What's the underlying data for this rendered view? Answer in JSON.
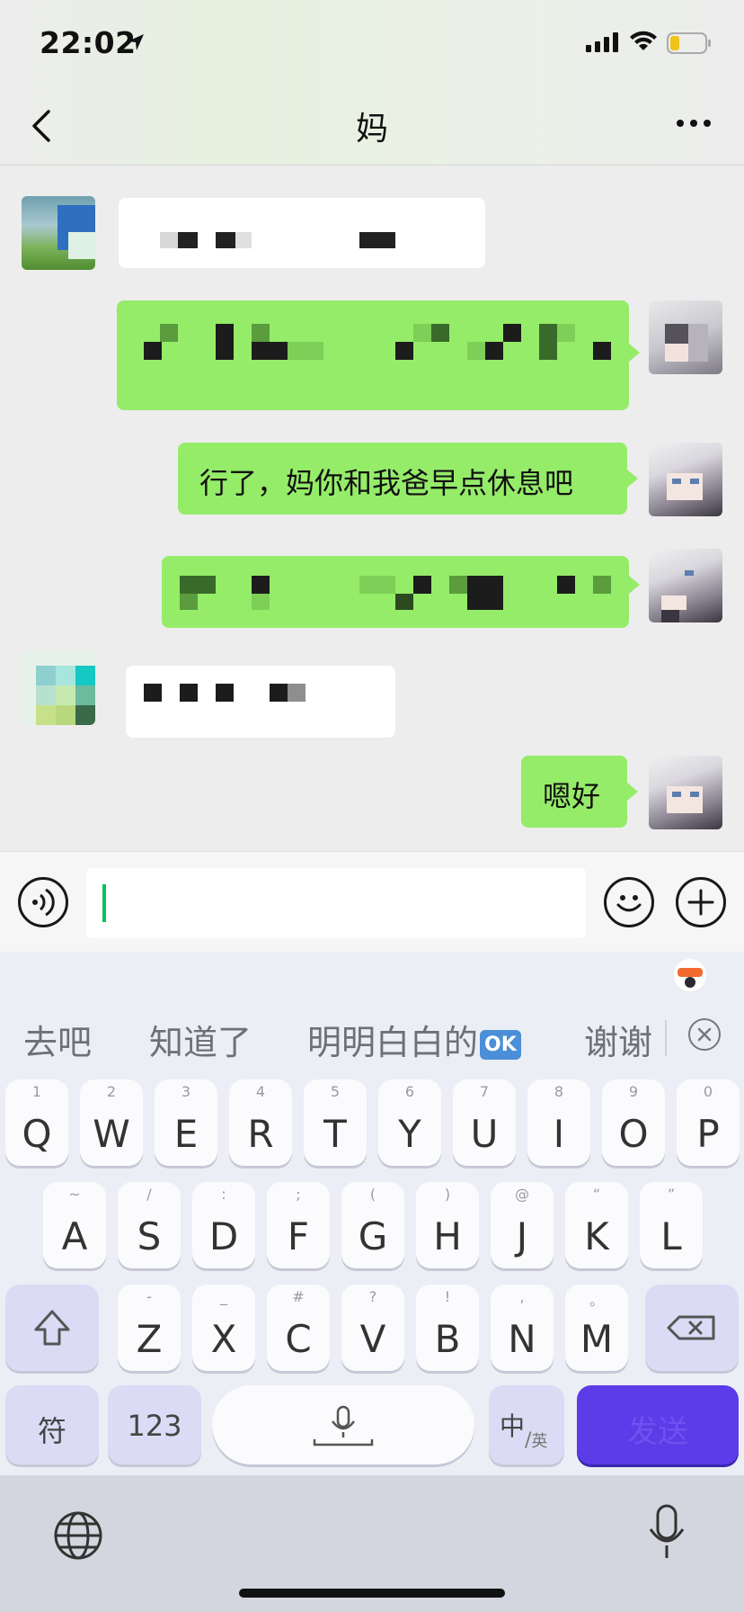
{
  "status_bar": {
    "time": "22:02"
  },
  "nav": {
    "title": "妈"
  },
  "messages": [
    {
      "side": "in",
      "text": ""
    },
    {
      "side": "out",
      "text": ""
    },
    {
      "side": "out",
      "text": "行了，妈你和我爸早点休息吧"
    },
    {
      "side": "out",
      "text": ""
    },
    {
      "side": "in",
      "text": ""
    },
    {
      "side": "out",
      "text": "嗯好"
    }
  ],
  "input": {
    "value": ""
  },
  "suggestions": [
    "去吧",
    "知道了",
    "明明白白的",
    "谢谢"
  ],
  "suggestion_badge": "OK",
  "keyboard": {
    "row1": [
      {
        "hint": "1",
        "label": "Q"
      },
      {
        "hint": "2",
        "label": "W"
      },
      {
        "hint": "3",
        "label": "E"
      },
      {
        "hint": "4",
        "label": "R"
      },
      {
        "hint": "5",
        "label": "T"
      },
      {
        "hint": "6",
        "label": "Y"
      },
      {
        "hint": "7",
        "label": "U"
      },
      {
        "hint": "8",
        "label": "I"
      },
      {
        "hint": "9",
        "label": "O"
      },
      {
        "hint": "0",
        "label": "P"
      }
    ],
    "row2": [
      {
        "hint": "~",
        "label": "A"
      },
      {
        "hint": "/",
        "label": "S"
      },
      {
        "hint": ":",
        "label": "D"
      },
      {
        "hint": ";",
        "label": "F"
      },
      {
        "hint": "(",
        "label": "G"
      },
      {
        "hint": ")",
        "label": "H"
      },
      {
        "hint": "@",
        "label": "J"
      },
      {
        "hint": "“",
        "label": "K"
      },
      {
        "hint": "”",
        "label": "L"
      }
    ],
    "row3": [
      {
        "hint": "-",
        "label": "Z"
      },
      {
        "hint": "_",
        "label": "X"
      },
      {
        "hint": "#",
        "label": "C"
      },
      {
        "hint": "?",
        "label": "V"
      },
      {
        "hint": "!",
        "label": "B"
      },
      {
        "hint": ",",
        "label": "N"
      },
      {
        "hint": "。",
        "label": "M"
      }
    ],
    "fu_label": "符",
    "num_label": "123",
    "lang_main": "中",
    "lang_sub": "英",
    "send_label": "发送"
  },
  "colors": {
    "sent_bubble": "#95ec69",
    "received_bubble": "#ffffff",
    "send_key": "#5b3ce8",
    "caret": "#07c160"
  }
}
